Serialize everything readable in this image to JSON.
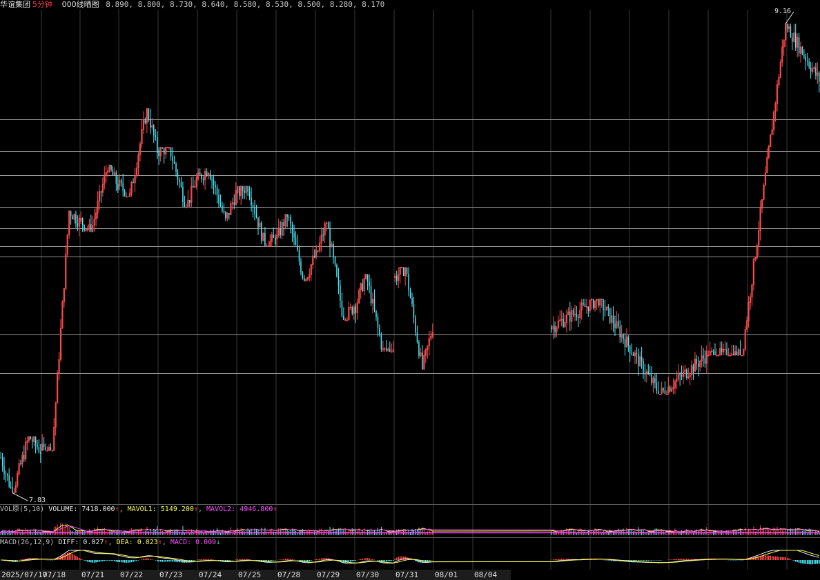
{
  "header": {
    "stock_name": "华谊集团",
    "period": "5分钟",
    "indicator_name": "000线晒图",
    "levels_text": "8.890, 8.800, 8.730, 8.640, 8.580, 8.530, 8.500, 8.280, 8.170"
  },
  "price_marks": {
    "high": "9.16",
    "low": "7.83"
  },
  "volume_panel": {
    "title": "VOL原(5,10)",
    "volume_label": "VOLUME: 7418.000",
    "volume_arrow": "↑",
    "mavol1_label": "MAVOL1: 5149.200",
    "mavol1_arrow": "↑",
    "mavol2_label": "MAVOL2: 4946.800",
    "mavol2_arrow": "↑"
  },
  "macd_panel": {
    "title": "MACD(26,12,9)",
    "diff_label": "DIFF: 0.027",
    "diff_arrow": "↑",
    "dea_label": "DEA: 0.023",
    "dea_arrow": "↑",
    "macd_label": "MACD: 0.009",
    "macd_arrow": "↓"
  },
  "date_axis": [
    "2025/07/17",
    "07/18",
    "07/21",
    "07/22",
    "07/23",
    "07/24",
    "07/25",
    "07/28",
    "07/29",
    "07/30",
    "07/31",
    "08/01",
    "08/04"
  ],
  "chart_data": {
    "type": "candlestick",
    "symbol": "华谊集团",
    "interval": "5分钟",
    "horizontal_levels": [
      8.89,
      8.8,
      8.73,
      8.64,
      8.58,
      8.53,
      8.5,
      8.28,
      8.17
    ],
    "ylim": [
      7.8,
      9.2
    ],
    "high": 9.16,
    "low": 7.83,
    "trend_by_day": [
      {
        "date": "2025/07/17",
        "open": 7.93,
        "high": 7.99,
        "low": 7.83,
        "close": 7.95
      },
      {
        "date": "07/18",
        "open": 7.95,
        "high": 8.63,
        "low": 7.95,
        "close": 8.6
      },
      {
        "date": "07/21",
        "open": 8.6,
        "high": 8.76,
        "low": 8.57,
        "close": 8.7
      },
      {
        "date": "07/22",
        "open": 8.7,
        "high": 8.92,
        "low": 8.67,
        "close": 8.8
      },
      {
        "date": "07/23",
        "open": 8.8,
        "high": 8.81,
        "low": 8.64,
        "close": 8.72
      },
      {
        "date": "07/24",
        "open": 8.72,
        "high": 8.75,
        "low": 8.6,
        "close": 8.68
      },
      {
        "date": "07/25",
        "open": 8.68,
        "high": 8.7,
        "low": 8.53,
        "close": 8.55
      },
      {
        "date": "07/28",
        "open": 8.55,
        "high": 8.62,
        "low": 8.43,
        "close": 8.5
      },
      {
        "date": "07/29",
        "open": 8.5,
        "high": 8.6,
        "low": 8.32,
        "close": 8.36
      },
      {
        "date": "07/30",
        "open": 8.36,
        "high": 8.45,
        "low": 8.23,
        "close": 8.24
      },
      {
        "date": "07/31",
        "open": 8.44,
        "high": 8.47,
        "low": 8.18,
        "close": 8.3
      },
      {
        "date": "08/01",
        "open": 8.3,
        "high": 8.38,
        "low": 8.11,
        "close": 8.22
      },
      {
        "date": "08/04",
        "open": 8.22,
        "high": 9.16,
        "low": 8.22,
        "close": 9.0
      }
    ]
  },
  "colors": {
    "up": "#ff4a4a",
    "down": "#4af0ff",
    "level_line": "#9a9a9a",
    "grid": "#3a3a3a",
    "mavol1": "#ffff4a",
    "mavol2": "#ff4aff",
    "diff_line": "#e8e8e8",
    "dea_line": "#ffff4a"
  }
}
